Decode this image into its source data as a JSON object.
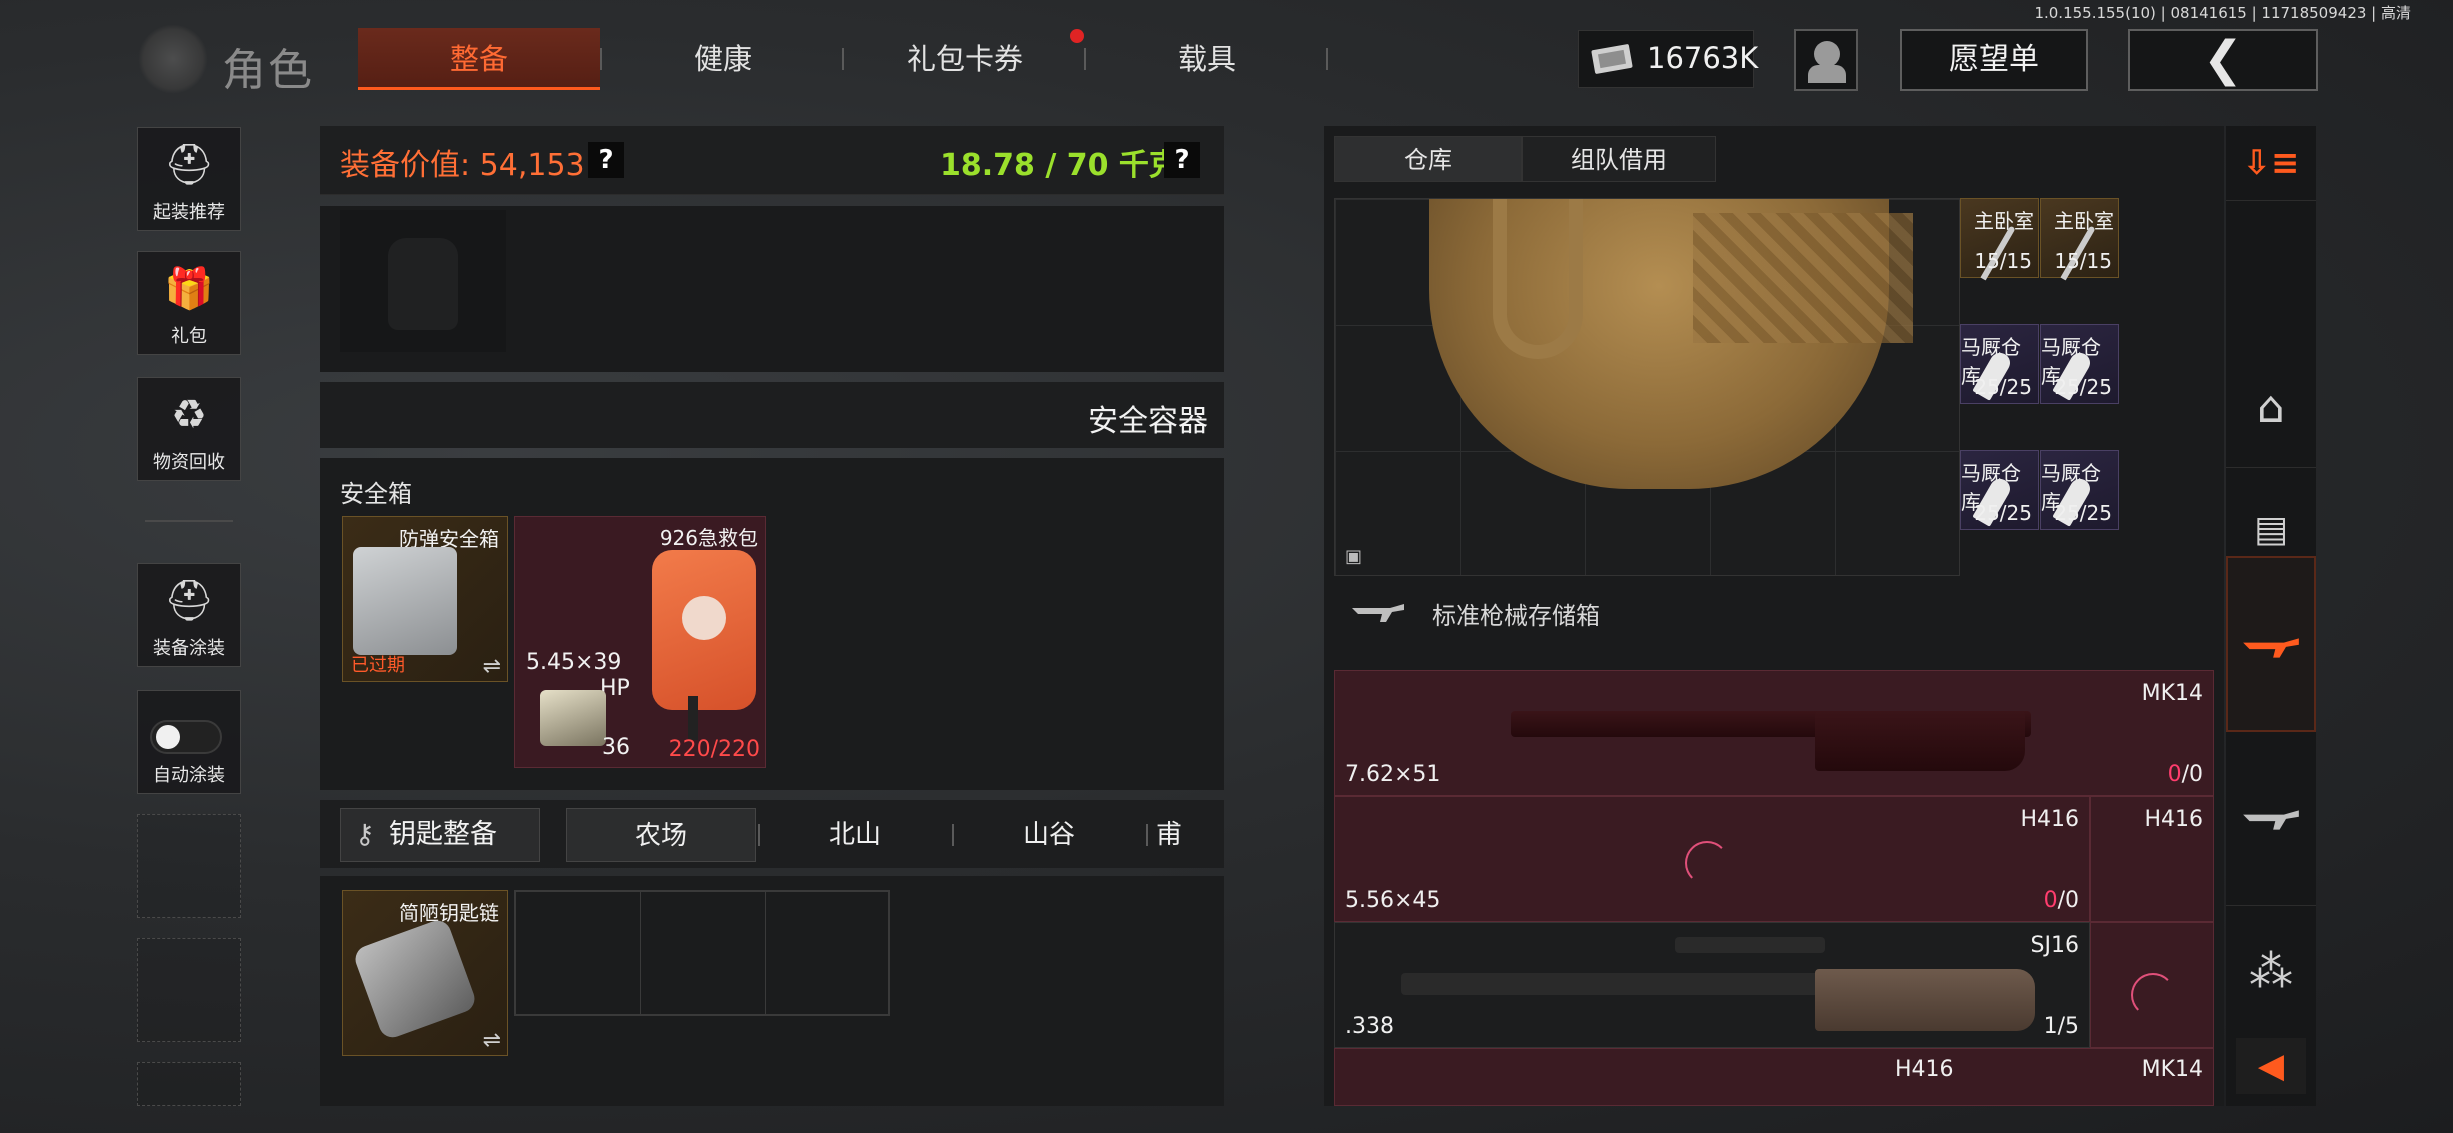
{
  "version_info": "1.0.155.155(10) | 08141615 | 11718509423 | 高清",
  "header": {
    "title": "角色",
    "tabs": [
      {
        "label": "整备",
        "active": true
      },
      {
        "label": "健康",
        "active": false
      },
      {
        "label": "礼包卡券",
        "active": false
      },
      {
        "label": "载具",
        "active": false
      }
    ],
    "currency": "16763K",
    "wishlist_label": "愿望单",
    "back_label": "❮"
  },
  "sidebar": {
    "items": [
      {
        "label": "起装推荐",
        "icon": "helmet-icon"
      },
      {
        "label": "礼包",
        "icon": "gift-icon"
      },
      {
        "label": "物资回收",
        "icon": "recycle-icon"
      },
      {
        "label": "装备涂装",
        "icon": "paint-icon"
      },
      {
        "label": "自动涂装",
        "icon": "toggle-icon"
      }
    ]
  },
  "equipment": {
    "value_label": "装备价值: 54,153",
    "weight_label": "18.78 / 70 千克",
    "help": "?",
    "safe_container_label": "安全容器",
    "safebox_title": "安全箱",
    "items": {
      "case_name": "防弹安全箱",
      "case_status": "已过期",
      "ammo_name": "5.45×39",
      "ammo_tag": "HP",
      "ammo_count": "36",
      "medkit_name": "926急救包",
      "medkit_durability": "220/220"
    },
    "keys_button": "钥匙整备",
    "key_tabs": [
      "农场",
      "北山",
      "山谷",
      "甫"
    ],
    "keychain_name": "简陋钥匙链",
    "swap_icon": "⇌"
  },
  "storage": {
    "tabs": [
      {
        "label": "仓库",
        "active": true
      },
      {
        "label": "组队借用",
        "active": false
      }
    ],
    "key_cells": [
      {
        "name": "主卧室",
        "count": "15/15",
        "style": "gold"
      },
      {
        "name": "主卧室",
        "count": "15/15",
        "style": "gold"
      },
      {
        "name": "马厩仓库",
        "count": "25/25",
        "style": "purple"
      },
      {
        "name": "马厩仓库",
        "count": "25/25",
        "style": "purple"
      },
      {
        "name": "马厩仓库",
        "count": "25/25",
        "style": "purple"
      },
      {
        "name": "马厩仓库",
        "count": "25/25",
        "style": "purple"
      }
    ],
    "rifle_box_label": "标准枪械存储箱",
    "weapons": [
      {
        "name": "MK14",
        "caliber": "7.62×51",
        "loaded": "0",
        "capacity": "/0"
      },
      {
        "name": "H416",
        "name2": "H416",
        "caliber": "5.56×45",
        "loaded": "0",
        "capacity": "/0"
      },
      {
        "name": "SJ16",
        "caliber": ".338",
        "ammo": "1/5"
      },
      {
        "name": "H416",
        "name2": "MK14"
      }
    ]
  },
  "colors": {
    "accent": "#ff5a1e",
    "value_orange": "#ff6f36",
    "weight_green": "#9be02c",
    "loaded_red": "#ff3d6e"
  }
}
